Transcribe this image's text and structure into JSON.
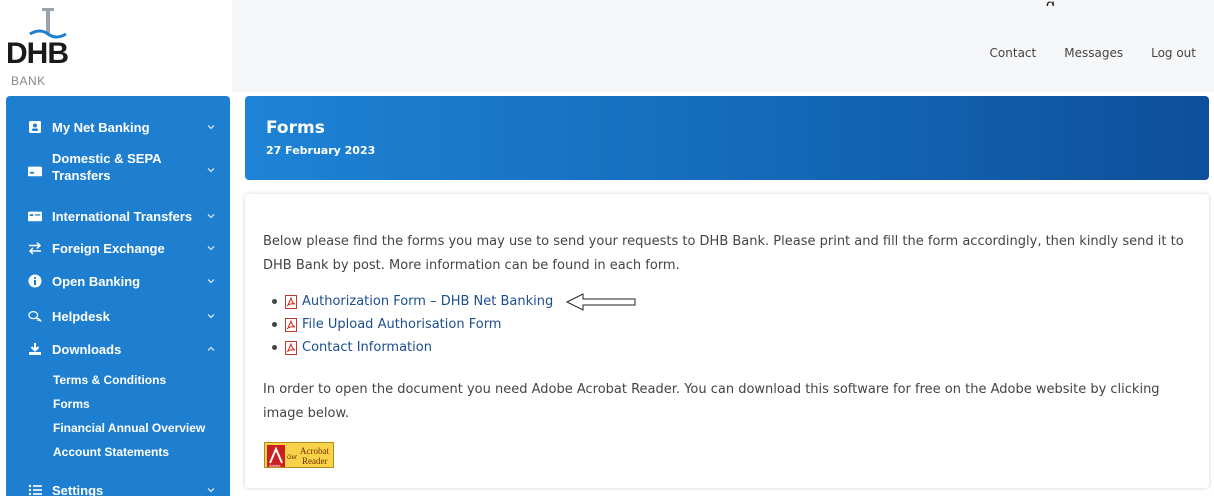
{
  "header": {
    "corner_text": "g",
    "logo": {
      "text": "DHB",
      "sub": "BANK"
    },
    "nav": [
      {
        "label": "Contact"
      },
      {
        "label": "Messages"
      },
      {
        "label": "Log out"
      }
    ]
  },
  "sidebar": {
    "items": [
      {
        "label": "My Net Banking",
        "icon": "account-card-icon",
        "expanded": false
      },
      {
        "label": "Domestic & SEPA Transfers",
        "label_line1": "Domestic & SEPA",
        "label_line2": "Transfers",
        "icon": "card-icon",
        "expanded": false
      },
      {
        "label": "International Transfers",
        "icon": "card-icon",
        "expanded": false
      },
      {
        "label": "Foreign Exchange",
        "icon": "exchange-icon",
        "expanded": false
      },
      {
        "label": "Open Banking",
        "icon": "info-icon",
        "expanded": false
      },
      {
        "label": "Helpdesk",
        "icon": "chat-icon",
        "expanded": false
      },
      {
        "label": "Downloads",
        "icon": "download-icon",
        "expanded": true
      },
      {
        "label": "Settings",
        "icon": "settings-list-icon",
        "expanded": false
      }
    ],
    "downloads_sub": [
      {
        "label": "Terms & Conditions"
      },
      {
        "label": "Forms",
        "active": true
      },
      {
        "label": "Financial Annual Overview"
      },
      {
        "label": "Account Statements"
      }
    ]
  },
  "main": {
    "title": "Forms",
    "date": "27 February 2023",
    "intro": "Below please find the forms you may use to send your requests to DHB Bank. Please print and fill the form accordingly, then kindly send it to DHB Bank by post. More information can be found in each form.",
    "links": [
      {
        "label": "Authorization Form – DHB Net Banking",
        "annotated": true
      },
      {
        "label": "File Upload Authorisation Form"
      },
      {
        "label": "Contact Information"
      }
    ],
    "note": "In order to open the document you need Adobe Acrobat Reader. You can download this software for free on the Adobe website by clicking image below.",
    "acrobat_badge": {
      "get": "Get",
      "brand_line1": "Acrobat",
      "brand_line2": "Reader",
      "maker": "Adobe"
    }
  },
  "colors": {
    "sidebar": "#1e7fd0",
    "title_gradient_start": "#1e83d6",
    "title_gradient_end": "#0d4f9a",
    "link": "#1d4e8c"
  }
}
